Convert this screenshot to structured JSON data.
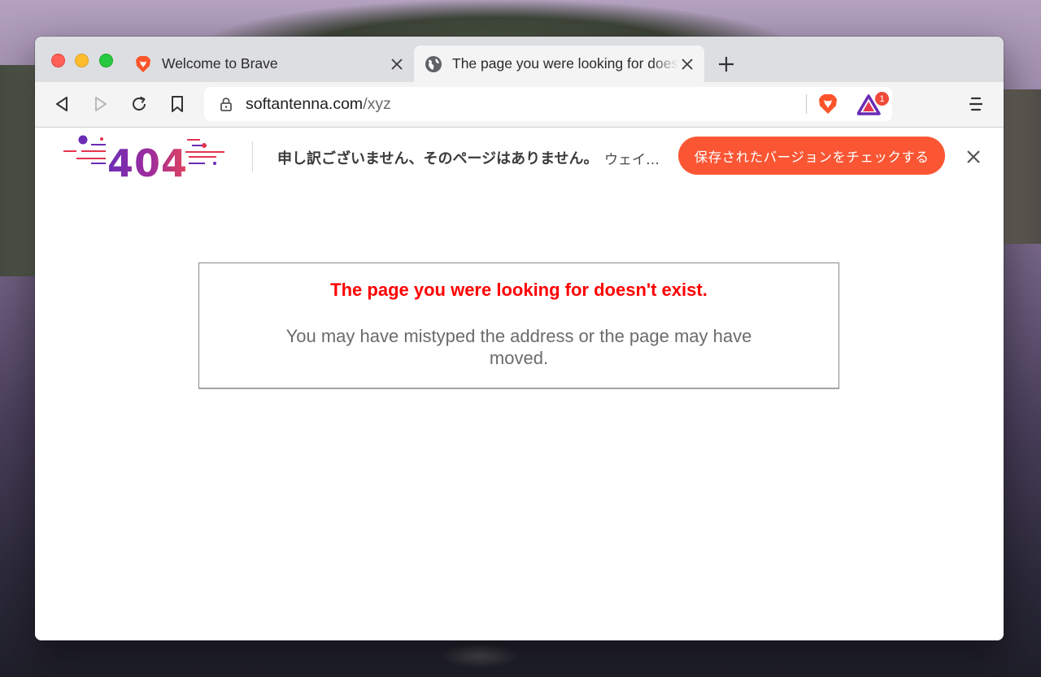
{
  "browser": {
    "tabs": [
      {
        "title": "Welcome to Brave",
        "icon": "brave-lion-icon",
        "active": false
      },
      {
        "title": "The page you were looking for doesn't exist.",
        "icon": "globe-icon",
        "active": true
      }
    ],
    "toolbar": {
      "url_host": "softantenna.com",
      "url_path": "/xyz",
      "rewards_badge_count": "1"
    }
  },
  "infobar": {
    "logo_text": "404",
    "message": "申し訳ございません、そのページはありません。",
    "more_text": "ウェイ…",
    "button_label": "保存されたバージョンをチェックする",
    "button_color": "#fa5634"
  },
  "page": {
    "error_title": "The page you were looking for doesn't exist.",
    "error_text": "You may have mistyped the address or the page may have moved.",
    "error_title_color": "#ff0000"
  }
}
